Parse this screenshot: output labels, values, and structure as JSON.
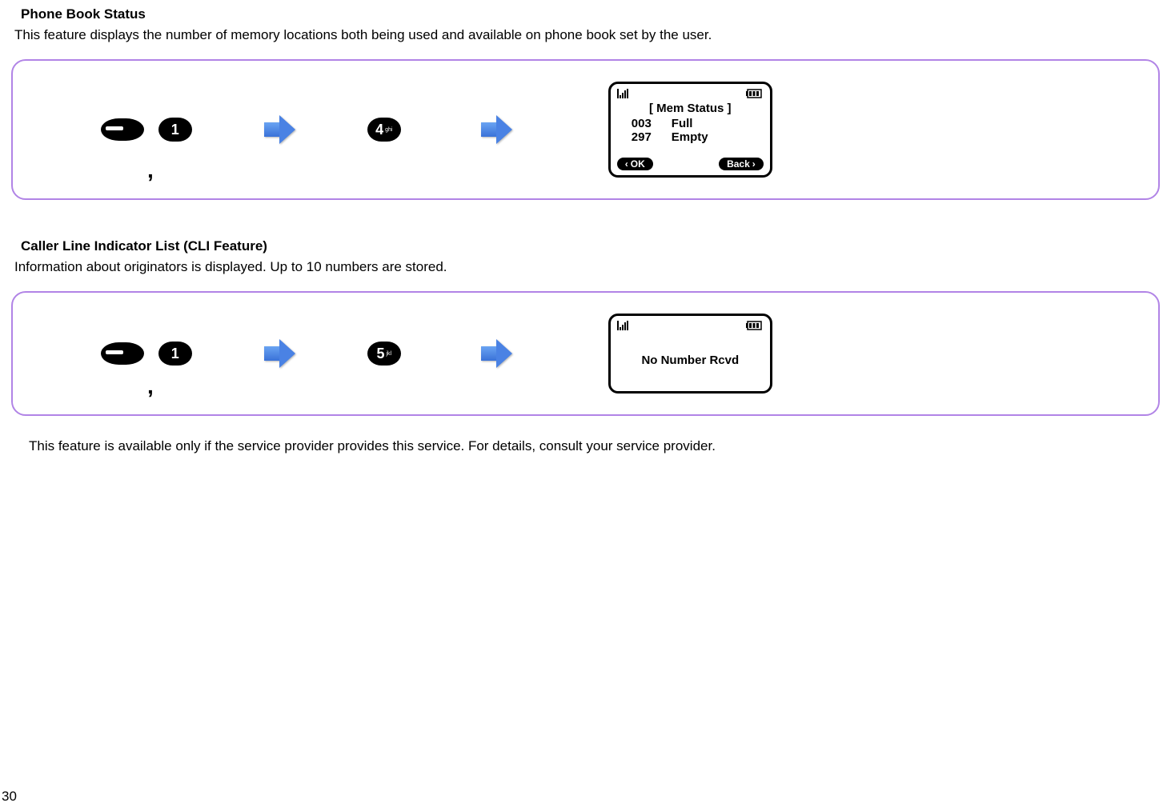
{
  "section1": {
    "title": "Phone Book Status",
    "desc": "This feature displays the number of memory locations both being used and available on phone book set by the user.",
    "keys": {
      "soft": "softkey",
      "num1": "1",
      "mid": "4",
      "mid_sub": "ghi"
    },
    "lcd": {
      "title": "[  Mem Status  ]",
      "row1_num": "003",
      "row1_label": "Full",
      "row2_num": "297",
      "row2_label": "Empty",
      "left_soft": "OK",
      "right_soft": "Back"
    }
  },
  "section2": {
    "title": "Caller Line Indicator List (CLI Feature)",
    "desc": "Information about originators is displayed. Up to 10 numbers are stored.",
    "keys": {
      "soft": "softkey",
      "num1": "1",
      "mid": "5",
      "mid_sub": "jkl"
    },
    "lcd": {
      "message": "No Number Rcvd"
    }
  },
  "footnote": "This feature is available only if the service provider provides this service. For details, consult your service provider.",
  "page": "30",
  "comma": ","
}
